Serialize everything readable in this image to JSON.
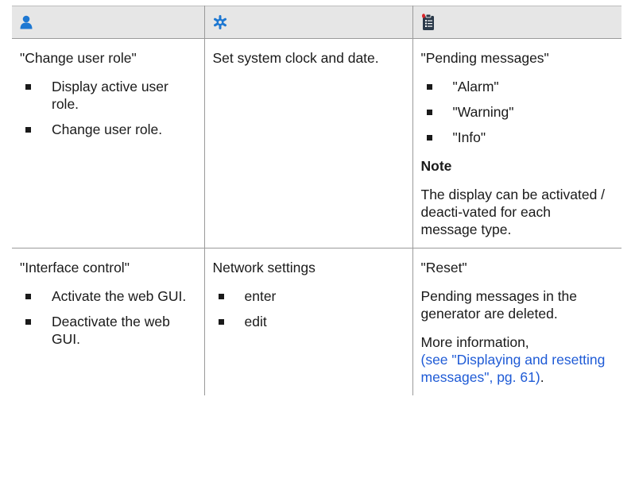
{
  "header": {
    "icons": [
      "user-role-icon",
      "settings-gear-icon",
      "messages-clipboard-icon"
    ],
    "colors": {
      "header_bg": "#e6e6e6",
      "icon_blue": "#1e78d2",
      "icon_dark": "#2b3a4a",
      "alert_red": "#d9262b",
      "link": "#1f5bd6"
    }
  },
  "rows": [
    {
      "user": {
        "title": "\"Change user role\"",
        "items": [
          "Display active user role.",
          "Change user role."
        ]
      },
      "settings": {
        "text": "Set system clock and date."
      },
      "messages": {
        "title": "\"Pending messages\"",
        "items": [
          "\"Alarm\"",
          "\"Warning\"",
          "\"Info\""
        ],
        "note_label": "Note",
        "note_text": "The display can be activated / deacti-vated for each message type."
      }
    },
    {
      "user": {
        "title": "\"Interface control\"",
        "items": [
          "Activate the web GUI.",
          "Deactivate the web GUI."
        ]
      },
      "settings": {
        "title": "Network settings",
        "items": [
          "enter",
          "edit"
        ]
      },
      "messages": {
        "title": "\"Reset\"",
        "text": "Pending messages in the generator are deleted.",
        "more_prefix": "More information,",
        "link_text": "(see \"Displaying and resetting messages\", pg. 61)",
        "suffix": "."
      }
    }
  ]
}
